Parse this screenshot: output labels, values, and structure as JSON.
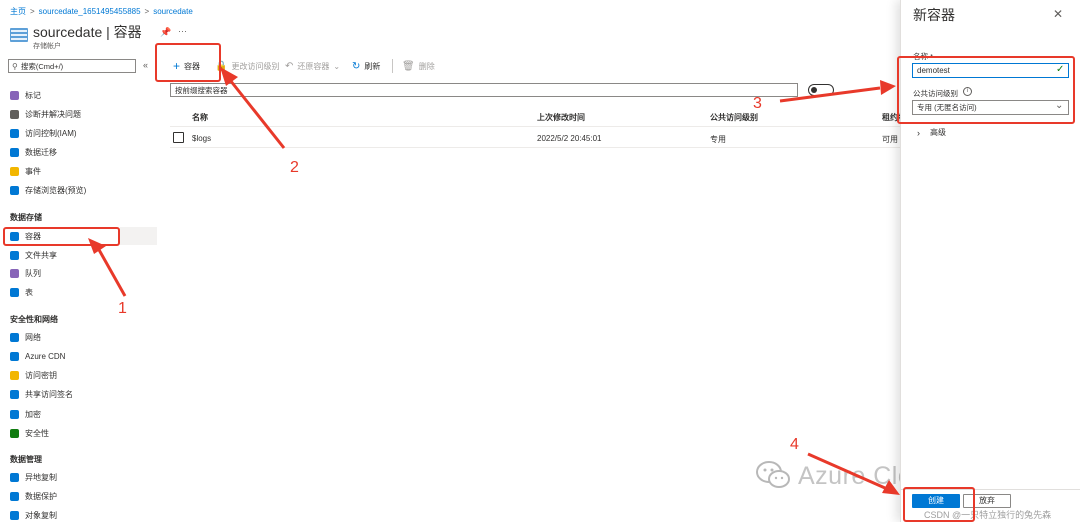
{
  "breadcrumb": {
    "home": "主页",
    "account": "sourcedate_1651495455885",
    "current": "sourcedate"
  },
  "header": {
    "title": "sourcedate | 容器",
    "subtitle": "存储帐户",
    "more": "···"
  },
  "search": {
    "placeholder": "搜索(Cmd+/)"
  },
  "sidebar": {
    "items_top": [
      {
        "label": "标记",
        "icon": "tag-icon",
        "color": "#8764b8"
      },
      {
        "label": "诊断并解决问题",
        "icon": "wrench-icon",
        "color": "#605e5c"
      },
      {
        "label": "访问控制(IAM)",
        "icon": "people-icon",
        "color": "#0078d4"
      },
      {
        "label": "数据迁移",
        "icon": "box-icon",
        "color": "#0078d4"
      },
      {
        "label": "事件",
        "icon": "lightning-icon",
        "color": "#f2b600"
      },
      {
        "label": "存储浏览器(预览)",
        "icon": "folder-icon",
        "color": "#0078d4"
      }
    ],
    "sec_data": "数据存储",
    "items_data": [
      {
        "label": "容器",
        "icon": "container-icon",
        "color": "#0078d4"
      },
      {
        "label": "文件共享",
        "icon": "fileshare-icon",
        "color": "#0078d4"
      },
      {
        "label": "队列",
        "icon": "queue-icon",
        "color": "#8764b8"
      },
      {
        "label": "表",
        "icon": "table-icon",
        "color": "#0078d4"
      }
    ],
    "sec_security": "安全性和网络",
    "items_security": [
      {
        "label": "网络",
        "icon": "network-icon",
        "color": "#0078d4"
      },
      {
        "label": "Azure CDN",
        "icon": "cloud-icon",
        "color": "#0078d4"
      },
      {
        "label": "访问密钥",
        "icon": "key-icon",
        "color": "#f2b600"
      },
      {
        "label": "共享访问签名",
        "icon": "link-icon",
        "color": "#0078d4"
      },
      {
        "label": "加密",
        "icon": "lock-icon",
        "color": "#0078d4"
      },
      {
        "label": "安全性",
        "icon": "shield-icon",
        "color": "#107c10"
      }
    ],
    "sec_manage": "数据管理",
    "items_manage": [
      {
        "label": "异地复制",
        "icon": "globe-icon",
        "color": "#0078d4"
      },
      {
        "label": "数据保护",
        "icon": "shield-icon",
        "color": "#0078d4"
      },
      {
        "label": "对象复制",
        "icon": "copy-icon",
        "color": "#0078d4"
      }
    ]
  },
  "toolbar": {
    "add": "容器",
    "change_access": "更改访问级别",
    "restore": "还原容器",
    "refresh": "刷新",
    "delete": "删除"
  },
  "filter": {
    "placeholder": "按前缀搜索容器"
  },
  "table": {
    "headers": {
      "name": "名称",
      "modified": "上次修改时间",
      "access": "公共访问级别",
      "lease": "租约状态"
    },
    "rows": [
      {
        "name": "$logs",
        "modified": "2022/5/2 20:45:01",
        "access": "专用",
        "lease": "可用"
      }
    ]
  },
  "panel": {
    "title": "新容器",
    "name_label": "名称 *",
    "name_value": "demotest",
    "access_label": "公共访问级别",
    "access_value": "专用 (无匿名访问)",
    "advanced": "高级",
    "create": "创建",
    "discard": "放弃"
  },
  "annotations": {
    "n1": "1",
    "n2": "2",
    "n3": "3",
    "n4": "4"
  },
  "watermark": {
    "brand": "Azure Cloud Service",
    "credit": "CSDN @一只特立独行的兔先森"
  },
  "colors": {
    "accent": "#0078d4",
    "annotation": "#e8392a"
  }
}
